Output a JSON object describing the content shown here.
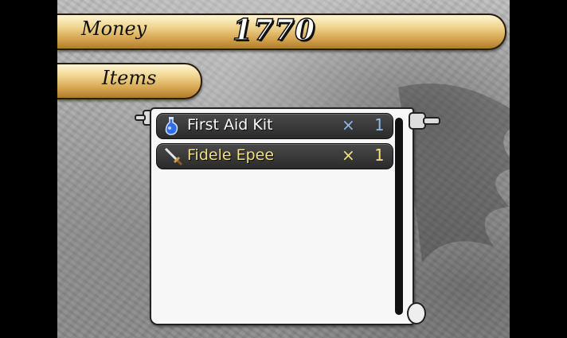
{
  "money": {
    "label": "Money",
    "value": "1770"
  },
  "items_tab": {
    "label": "Items"
  },
  "inventory": [
    {
      "name": "First Aid Kit",
      "times": "×",
      "qty": "1",
      "icon": "potion-icon"
    },
    {
      "name": "Fidele Epee",
      "times": "×",
      "qty": "1",
      "icon": "sword-icon"
    }
  ],
  "colors": {
    "banner": "#e8c27a",
    "row": "#2f2f2f",
    "selected_text": "#f3e27a",
    "normal_text": "#ffffff"
  }
}
